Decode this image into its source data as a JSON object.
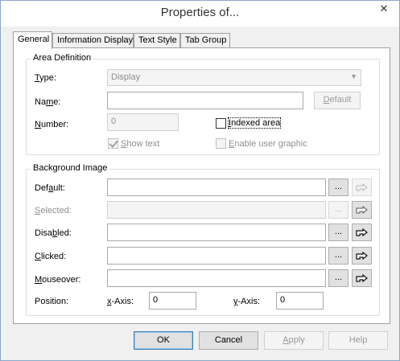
{
  "window": {
    "title": "Properties of..."
  },
  "tabs": [
    {
      "label": "General",
      "active": true
    },
    {
      "label": "Information Display",
      "active": false
    },
    {
      "label": "Text Style",
      "active": false
    },
    {
      "label": "Tab Group",
      "active": false
    }
  ],
  "area_definition": {
    "title": "Area Definition",
    "type_label": "Type:",
    "type_value": "Display",
    "name_label": "Name:",
    "name_value": "",
    "default_button": "Default",
    "number_label": "Number:",
    "number_value": "0",
    "indexed_area_label": "Indexed area",
    "indexed_area_checked": false,
    "show_text_label": "Show text",
    "show_text_checked": true,
    "enable_user_graphic_label": "Enable user graphic",
    "enable_user_graphic_checked": false
  },
  "background_image": {
    "title": "Background Image",
    "rows": [
      {
        "label": "Default:",
        "value": "",
        "enabled": true,
        "browse": "...",
        "icon": "hand-pointer-icon"
      },
      {
        "label": "Selected:",
        "value": "",
        "enabled": false,
        "browse": "...",
        "icon": "hand-pointer-icon"
      },
      {
        "label": "Disabled:",
        "value": "",
        "enabled": true,
        "browse": "...",
        "icon": "hand-pointer-icon"
      },
      {
        "label": "Clicked:",
        "value": "",
        "enabled": true,
        "browse": "...",
        "icon": "hand-pointer-icon"
      },
      {
        "label": "Mouseover:",
        "value": "",
        "enabled": true,
        "browse": "...",
        "icon": "hand-pointer-icon"
      }
    ],
    "position_label": "Position:",
    "x_axis_label": "x-Axis:",
    "x_axis_value": "0",
    "y_axis_label": "y-Axis:",
    "y_axis_value": "0"
  },
  "footer": {
    "ok": "OK",
    "cancel": "Cancel",
    "apply": "Apply",
    "help": "Help"
  }
}
